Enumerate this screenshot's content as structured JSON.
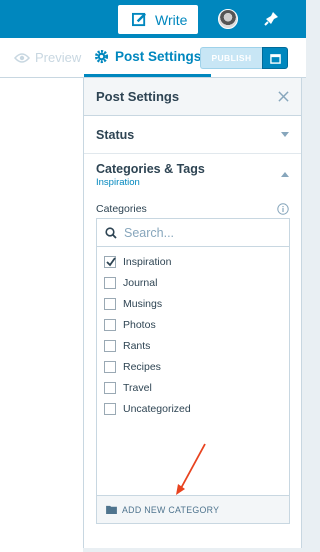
{
  "masterbar": {
    "write_label": "Write",
    "icons": [
      "write-icon",
      "avatar",
      "notifications-icon"
    ]
  },
  "toolbar": {
    "preview_label": "Preview",
    "post_settings_tab": "Post Settings",
    "publish_label": "PUBLISH",
    "icons": [
      "eye-icon",
      "gear-icon",
      "calendar-icon"
    ]
  },
  "sidebar": {
    "title": "Post Settings",
    "status_label": "Status",
    "categories_tags": {
      "title": "Categories & Tags",
      "subtitle": "Inspiration"
    },
    "categories_label": "Categories",
    "search_placeholder": "Search...",
    "categories": [
      {
        "label": "Inspiration",
        "checked": true
      },
      {
        "label": "Journal",
        "checked": false
      },
      {
        "label": "Musings",
        "checked": false
      },
      {
        "label": "Photos",
        "checked": false
      },
      {
        "label": "Rants",
        "checked": false
      },
      {
        "label": "Recipes",
        "checked": false
      },
      {
        "label": "Travel",
        "checked": false
      },
      {
        "label": "Uncategorized",
        "checked": false
      }
    ],
    "add_new_label": "ADD NEW CATEGORY"
  },
  "colors": {
    "accent": "#0087be",
    "annotation_arrow": "#e8431f"
  }
}
